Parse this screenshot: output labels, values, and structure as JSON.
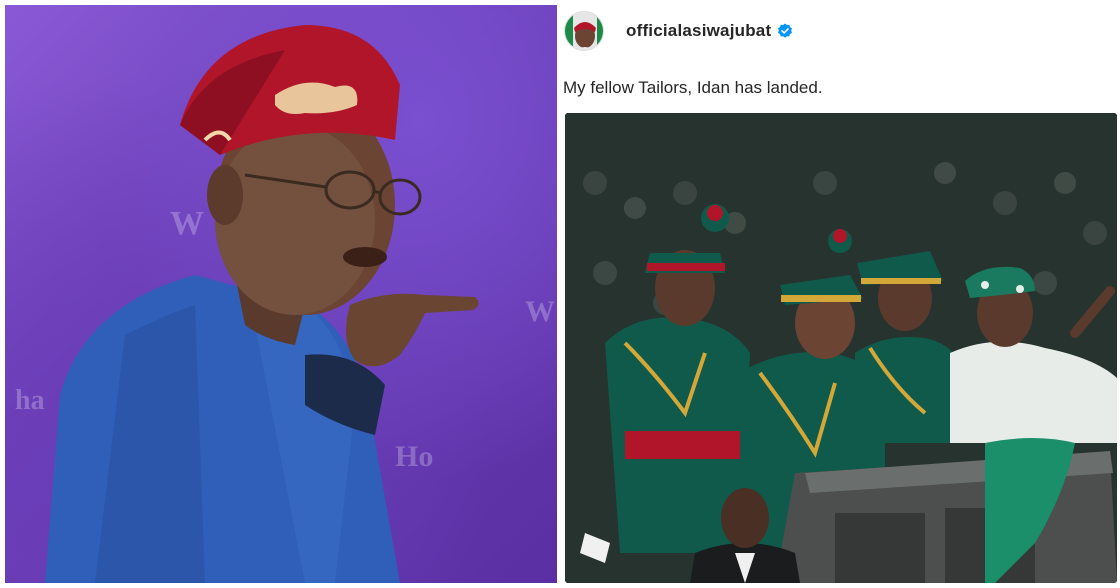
{
  "post": {
    "username": "officialasiwajubat",
    "caption": "My fellow Tailors, Idan has landed."
  },
  "colors": {
    "left_background": "#6b3fb6",
    "verified_badge": "#0095f6",
    "uniform_green": "#0f5a4a",
    "cap_red": "#b0152a",
    "agbada_blue": "#2f5fb8"
  },
  "icons": {
    "verified": "verified-badge-icon"
  }
}
